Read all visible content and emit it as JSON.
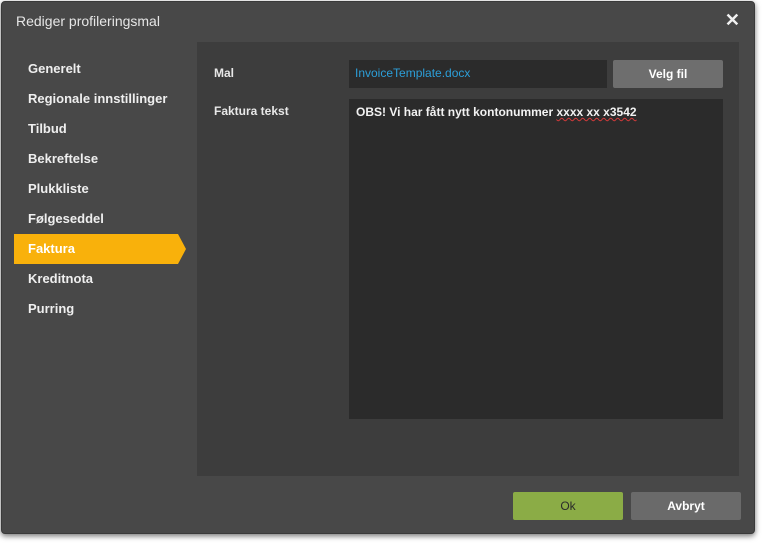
{
  "dialog": {
    "title": "Rediger profileringsmal",
    "close_glyph": "✕",
    "close_icon": "close-icon"
  },
  "sidebar": {
    "active_index": 6,
    "items": [
      {
        "label": "Generelt"
      },
      {
        "label": "Regionale innstillinger"
      },
      {
        "label": "Tilbud"
      },
      {
        "label": "Bekreftelse"
      },
      {
        "label": "Plukkliste"
      },
      {
        "label": "Følgeseddel"
      },
      {
        "label": "Faktura"
      },
      {
        "label": "Kreditnota"
      },
      {
        "label": "Purring"
      }
    ]
  },
  "form": {
    "template_label": "Mal",
    "template_value": "InvoiceTemplate.docx",
    "choose_file_label": "Velg fil",
    "invoice_text_label": "Faktura tekst",
    "invoice_text_plain": "OBS! Vi har fått nytt kontonummer ",
    "invoice_text_marked": "xxxx xx x3542"
  },
  "footer": {
    "ok_label": "Ok",
    "cancel_label": "Avbryt"
  },
  "colors": {
    "accent": "#f9b10b",
    "ok": "#8bac46",
    "link": "#2c9fd9"
  }
}
